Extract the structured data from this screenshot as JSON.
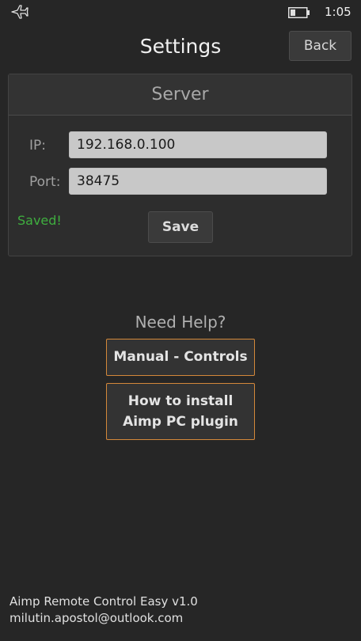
{
  "status_bar": {
    "time": "1:05",
    "icons": [
      "airplane-icon",
      "battery-icon"
    ]
  },
  "header": {
    "title": "Settings",
    "back_label": "Back"
  },
  "server": {
    "title": "Server",
    "ip_label": "IP:",
    "ip_value": "192.168.0.100",
    "port_label": "Port:",
    "port_value": "38475",
    "saved_status": "Saved!",
    "save_label": "Save"
  },
  "help": {
    "title": "Need Help?",
    "manual_label": "Manual - Controls",
    "install_line1": "How to install",
    "install_line2": "Aimp PC plugin"
  },
  "footer": {
    "app_version": "Aimp Remote Control Easy v1.0",
    "email": "milutin.apostol@outlook.com"
  },
  "colors": {
    "background": "#262626",
    "accent_border": "#d4883a",
    "saved_green": "#3fae3f"
  }
}
